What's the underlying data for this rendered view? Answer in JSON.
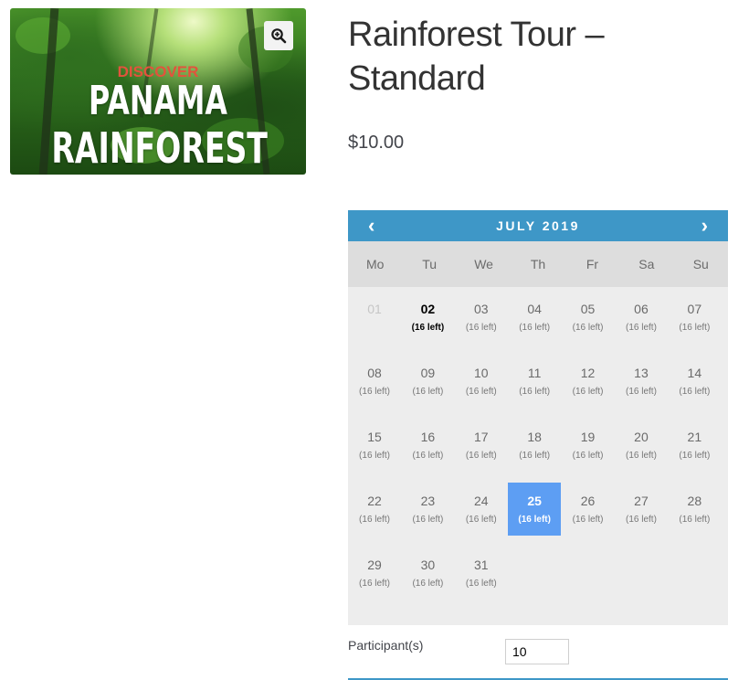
{
  "product": {
    "image": {
      "overlay_small": "DISCOVER",
      "overlay_line1": "PANAMA",
      "overlay_line2": "RAINFOREST"
    },
    "title": "Rainforest Tour – Standard",
    "price": "$10.00"
  },
  "calendar": {
    "month_label": "JULY 2019",
    "prev_symbol": "‹",
    "next_symbol": "›",
    "weekdays": [
      "Mo",
      "Tu",
      "We",
      "Th",
      "Fr",
      "Sa",
      "Su"
    ],
    "days": [
      {
        "num": "01",
        "left": "",
        "state": "past"
      },
      {
        "num": "02",
        "left": "(16 left)",
        "state": "today"
      },
      {
        "num": "03",
        "left": "(16 left)",
        "state": ""
      },
      {
        "num": "04",
        "left": "(16 left)",
        "state": ""
      },
      {
        "num": "05",
        "left": "(16 left)",
        "state": ""
      },
      {
        "num": "06",
        "left": "(16 left)",
        "state": ""
      },
      {
        "num": "07",
        "left": "(16 left)",
        "state": ""
      },
      {
        "num": "08",
        "left": "(16 left)",
        "state": ""
      },
      {
        "num": "09",
        "left": "(16 left)",
        "state": ""
      },
      {
        "num": "10",
        "left": "(16 left)",
        "state": ""
      },
      {
        "num": "11",
        "left": "(16 left)",
        "state": ""
      },
      {
        "num": "12",
        "left": "(16 left)",
        "state": ""
      },
      {
        "num": "13",
        "left": "(16 left)",
        "state": ""
      },
      {
        "num": "14",
        "left": "(16 left)",
        "state": ""
      },
      {
        "num": "15",
        "left": "(16 left)",
        "state": ""
      },
      {
        "num": "16",
        "left": "(16 left)",
        "state": ""
      },
      {
        "num": "17",
        "left": "(16 left)",
        "state": ""
      },
      {
        "num": "18",
        "left": "(16 left)",
        "state": ""
      },
      {
        "num": "19",
        "left": "(16 left)",
        "state": ""
      },
      {
        "num": "20",
        "left": "(16 left)",
        "state": ""
      },
      {
        "num": "21",
        "left": "(16 left)",
        "state": ""
      },
      {
        "num": "22",
        "left": "(16 left)",
        "state": ""
      },
      {
        "num": "23",
        "left": "(16 left)",
        "state": ""
      },
      {
        "num": "24",
        "left": "(16 left)",
        "state": ""
      },
      {
        "num": "25",
        "left": "(16 left)",
        "state": "selected"
      },
      {
        "num": "26",
        "left": "(16 left)",
        "state": ""
      },
      {
        "num": "27",
        "left": "(16 left)",
        "state": ""
      },
      {
        "num": "28",
        "left": "(16 left)",
        "state": ""
      },
      {
        "num": "29",
        "left": "(16 left)",
        "state": ""
      },
      {
        "num": "30",
        "left": "(16 left)",
        "state": ""
      },
      {
        "num": "31",
        "left": "(16 left)",
        "state": ""
      }
    ]
  },
  "participants": {
    "label": "Participant(s)",
    "value": "10"
  },
  "colors": {
    "header_blue": "#3e97c7",
    "selected_blue": "#5d9ef3",
    "discover_red": "#e2533c"
  },
  "icons": {
    "zoom": "magnifier-plus-icon",
    "prev": "chevron-left-icon",
    "next": "chevron-right-icon"
  }
}
